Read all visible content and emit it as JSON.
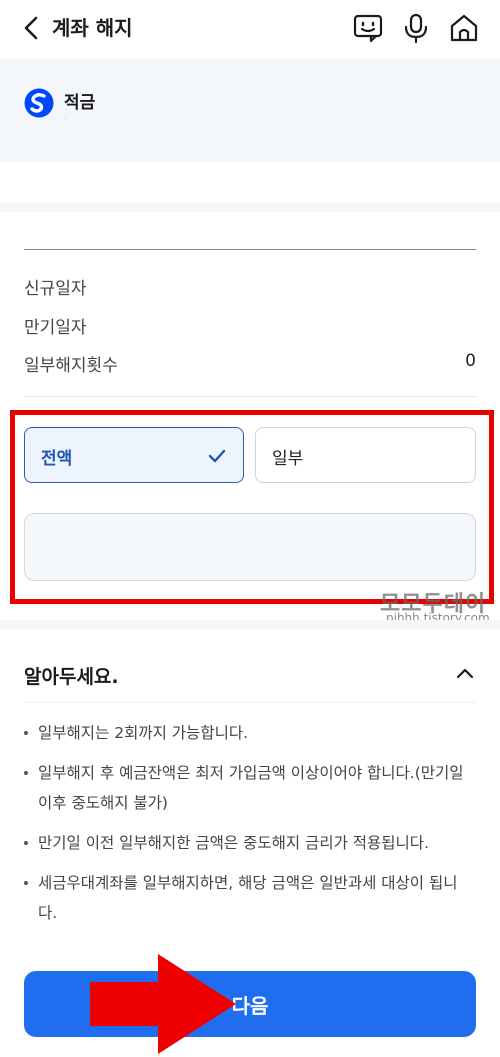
{
  "header": {
    "title": "계좌 해지",
    "icons": [
      "back-icon",
      "chat-bot-icon",
      "microphone-icon",
      "home-icon"
    ]
  },
  "account": {
    "name": "적금",
    "sub": "·"
  },
  "info": {
    "rows": [
      {
        "label": "신규일자",
        "value": ""
      },
      {
        "label": "만기일자",
        "value": ""
      },
      {
        "label": "일부해지횟수",
        "value": "0"
      }
    ]
  },
  "options": {
    "full_label": "전액",
    "partial_label": "일부",
    "selected": "full"
  },
  "amount": {
    "value": ""
  },
  "watermark": {
    "main": "모모두데이",
    "sub": "pjhhh.tistory.com"
  },
  "notice": {
    "title": "알아두세요.",
    "items": [
      "일부해지는 2회까지 가능합니다.",
      "일부해지 후 예금잔액은 최저 가입금액 이상이어야 합니다.(만기일 이후 중도해지 불가)",
      "만기일 이전 일부해지한 금액은 중도해지 금리가 적용됩니다.",
      "세금우대계좌를 일부해지하면, 해당 금액은 일반과세 대상이 됩니다."
    ]
  },
  "footer": {
    "next_label": "다음"
  },
  "colors": {
    "primary": "#1f6ef0",
    "selected_border": "#2c5fb3",
    "highlight": "#e60000",
    "section_bg": "#f3f6fb"
  }
}
